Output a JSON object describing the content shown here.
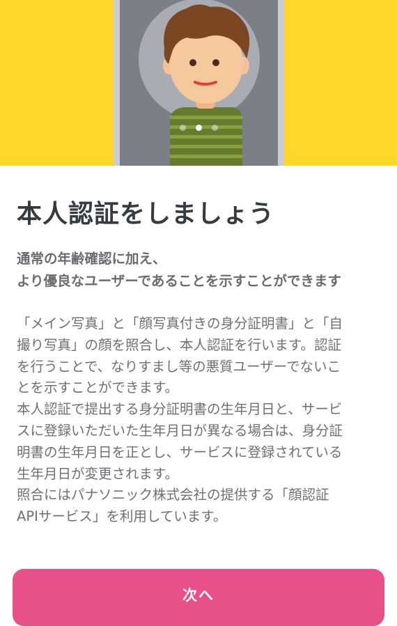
{
  "hero": {
    "illustration": "selfie-avatar-illustration",
    "carousel": {
      "total_pages": 3,
      "current_page": 2
    }
  },
  "title": "本人認証をしましょう",
  "lead_lines": [
    "通常の年齢確認に加え、",
    "より優良なユーザーであることを示すことができます"
  ],
  "body_lines": [
    "「メイン写真」と「顔写真付きの身分証明書」と「自",
    "撮り写真」の顔を照合し、本人認証を行います。認証",
    "を行うことで、なりすまし等の悪質ユーザーでないこ",
    "とを示すことができます。",
    "本人認証で提出する身分証明書の生年月日と、サービ",
    "スに登録いただいた生年月日が異なる場合は、身分証",
    "明書の生年月日を正とし、サービスに登録されている",
    "生年月日が変更されます。",
    "照合にはパナソニック株式会社の提供する「顔認証",
    "APIサービス」を利用しています。"
  ],
  "next_button_label": "次へ",
  "colors": {
    "hero_background": "#fdd72a",
    "button_background": "#e8508a",
    "title_text": "#363b40",
    "body_text": "#6c7075"
  }
}
